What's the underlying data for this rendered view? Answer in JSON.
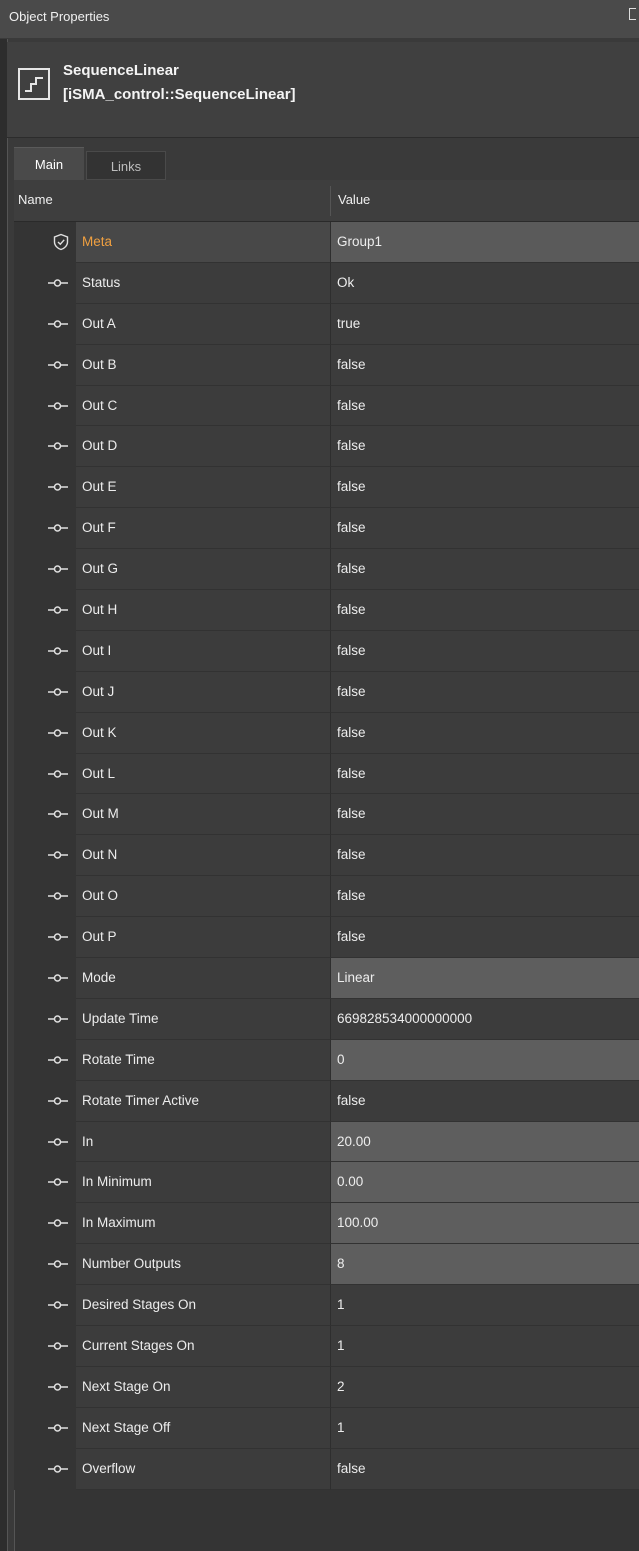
{
  "window": {
    "title": "Object Properties"
  },
  "object": {
    "name": "SequenceLinear",
    "type": "[iSMA_control::SequenceLinear]"
  },
  "tabs": [
    {
      "label": "Main"
    },
    {
      "label": "Links"
    }
  ],
  "columns": {
    "name": "Name",
    "value": "Value"
  },
  "rows": [
    {
      "name": "Meta",
      "value": "Group1"
    },
    {
      "name": "Status",
      "value": "Ok"
    },
    {
      "name": "Out A",
      "value": "true"
    },
    {
      "name": "Out B",
      "value": "false"
    },
    {
      "name": "Out C",
      "value": "false"
    },
    {
      "name": "Out D",
      "value": "false"
    },
    {
      "name": "Out E",
      "value": "false"
    },
    {
      "name": "Out F",
      "value": "false"
    },
    {
      "name": "Out G",
      "value": "false"
    },
    {
      "name": "Out H",
      "value": "false"
    },
    {
      "name": "Out I",
      "value": "false"
    },
    {
      "name": "Out J",
      "value": "false"
    },
    {
      "name": "Out K",
      "value": "false"
    },
    {
      "name": "Out L",
      "value": "false"
    },
    {
      "name": "Out M",
      "value": "false"
    },
    {
      "name": "Out N",
      "value": "false"
    },
    {
      "name": "Out O",
      "value": "false"
    },
    {
      "name": "Out P",
      "value": "false"
    },
    {
      "name": "Mode",
      "value": "Linear"
    },
    {
      "name": "Update Time",
      "value": "669828534000000000"
    },
    {
      "name": "Rotate Time",
      "value": "0"
    },
    {
      "name": "Rotate Timer Active",
      "value": "false"
    },
    {
      "name": "In",
      "value": "20.00"
    },
    {
      "name": "In Minimum",
      "value": "0.00"
    },
    {
      "name": "In Maximum",
      "value": "100.00"
    },
    {
      "name": "Number Outputs",
      "value": "8"
    },
    {
      "name": "Desired Stages On",
      "value": "1"
    },
    {
      "name": "Current Stages On",
      "value": "1"
    },
    {
      "name": "Next Stage On",
      "value": "2"
    },
    {
      "name": "Next Stage Off",
      "value": "1"
    },
    {
      "name": "Overflow",
      "value": "false"
    }
  ]
}
